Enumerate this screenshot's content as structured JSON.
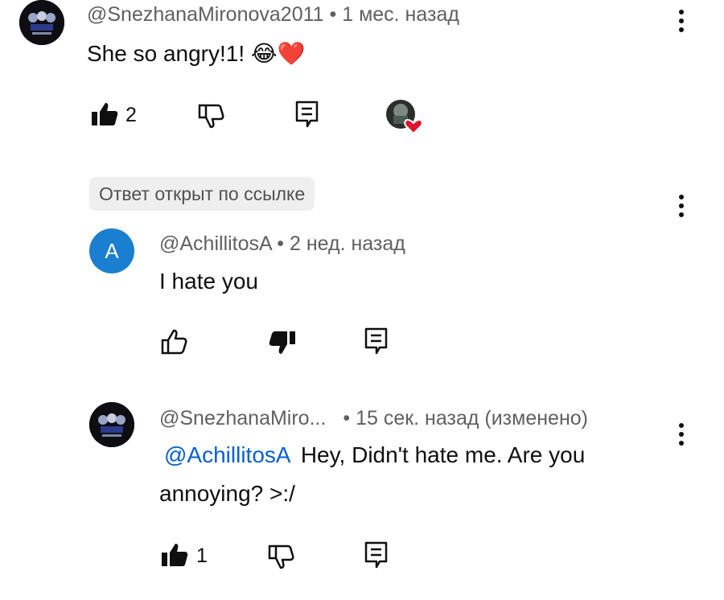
{
  "comments": [
    {
      "author": "@SnezhanaMironova2011",
      "time": "• 1 мес. назад",
      "text": "She so angry!1! 😂❤️",
      "likes": "2"
    }
  ],
  "reply_section": {
    "chip_label": "Ответ открыт по ссылке"
  },
  "replies": [
    {
      "avatar_letter": "A",
      "author": "@AchillitosA",
      "time": "• 2 нед. назад",
      "text": "I hate you"
    },
    {
      "author": "@SnezhanaMiro...",
      "time": "• 15 сек. назад (изменено)",
      "mention": "@AchillitosA",
      "text_line1": "Hey, Didn't hate me. Are you",
      "text_line2": "annoying? >:/",
      "likes": "1"
    }
  ],
  "colors": {
    "mention": "#065fd4",
    "avatar_letter_bg": "#1a7fd0",
    "heart": "#e0142b"
  }
}
